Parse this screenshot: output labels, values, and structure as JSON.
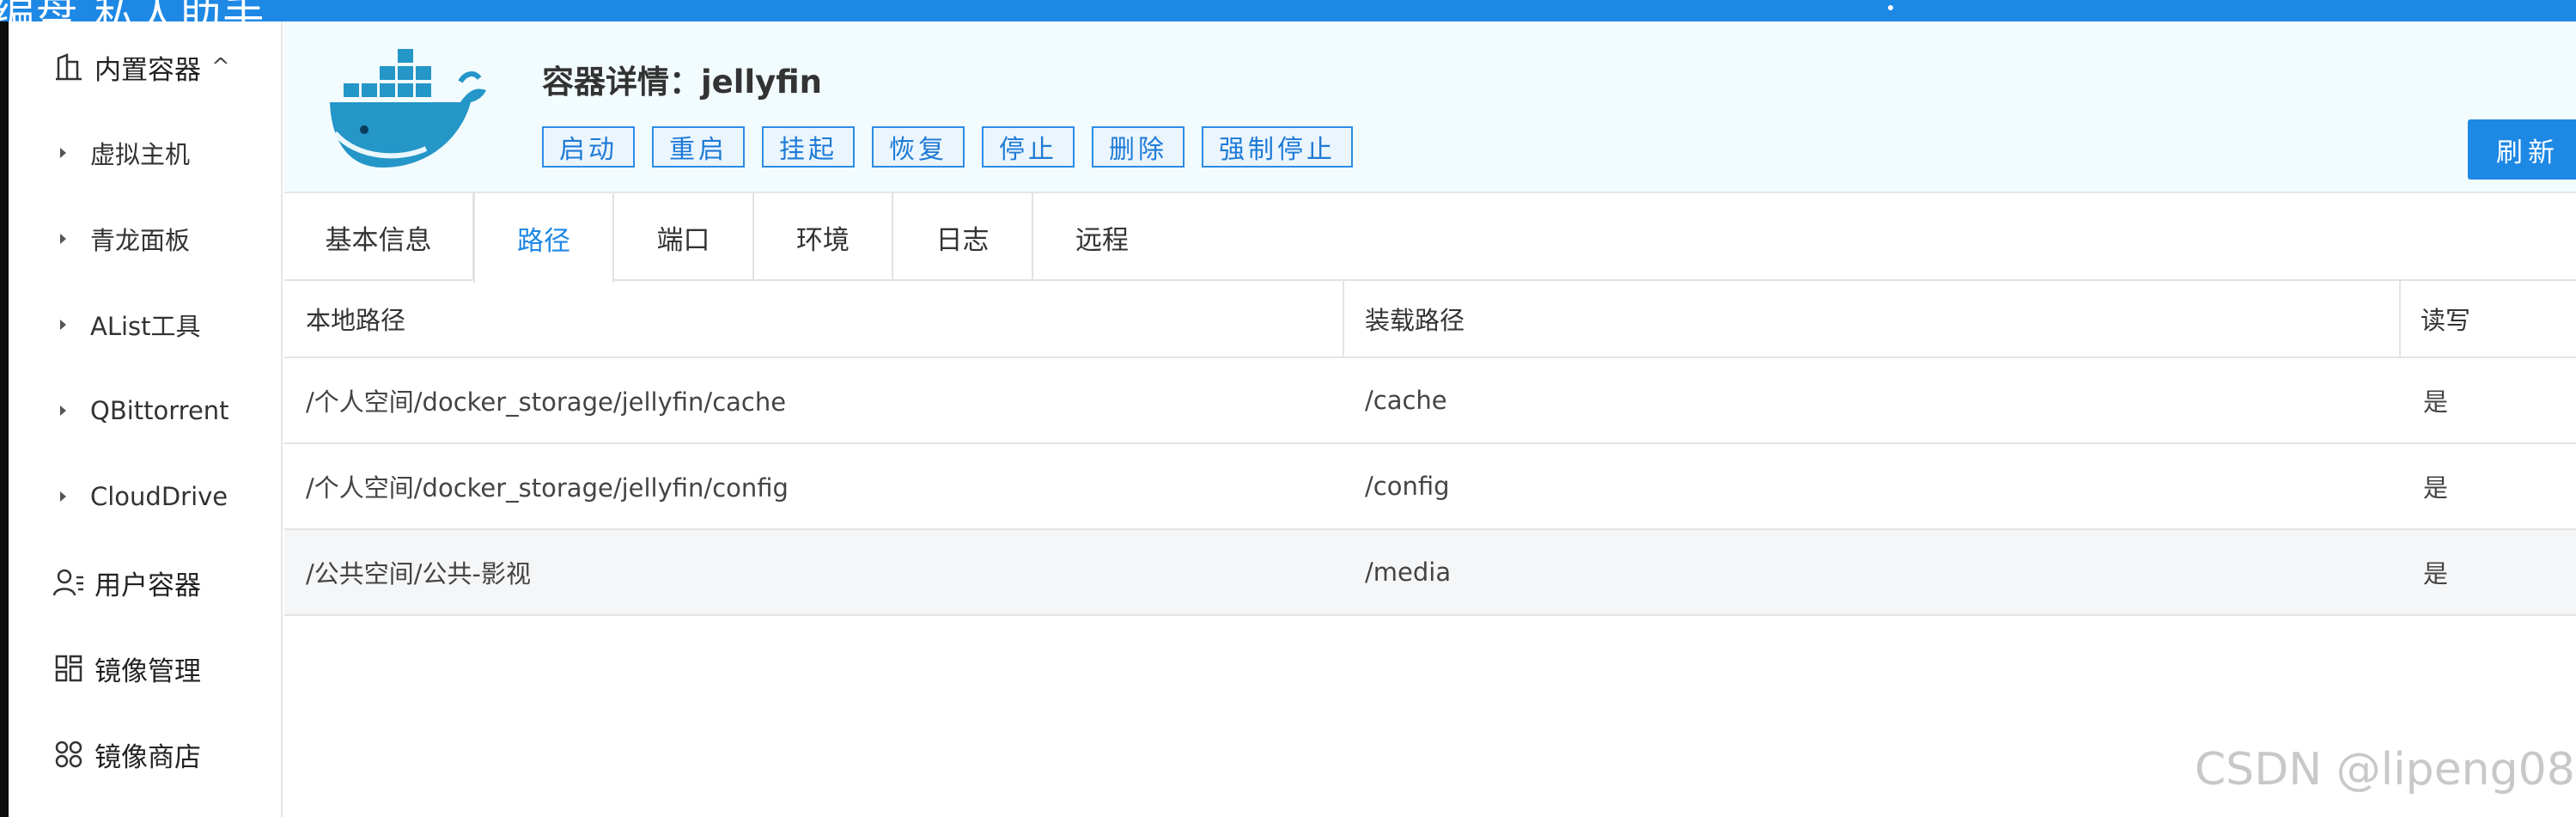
{
  "topbar": {
    "brand_text": "编盘 私人助手"
  },
  "sidebar": {
    "builtin": {
      "label": "内置容器",
      "chevron": "^"
    },
    "sub_items": [
      {
        "label": "虚拟主机"
      },
      {
        "label": "青龙面板"
      },
      {
        "label": "AList工具"
      },
      {
        "label": "QBittorrent"
      },
      {
        "label": "CloudDrive"
      }
    ],
    "items": [
      {
        "label": "用户容器",
        "icon": "user-list-icon"
      },
      {
        "label": "镜像管理",
        "icon": "grid-icon"
      },
      {
        "label": "镜像商店",
        "icon": "apps-icon"
      }
    ]
  },
  "header": {
    "title": "容器详情：jellyfin",
    "actions": [
      "启动",
      "重启",
      "挂起",
      "恢复",
      "停止",
      "删除",
      "强制停止"
    ],
    "refresh": "刷新"
  },
  "tabs": [
    "基本信息",
    "路径",
    "端口",
    "环境",
    "日志",
    "远程"
  ],
  "active_tab": "路径",
  "table": {
    "columns": [
      "本地路径",
      "装载路径",
      "读写"
    ],
    "rows": [
      [
        "/个人空间/docker_storage/jellyfin/cache",
        "/cache",
        "是"
      ],
      [
        "/个人空间/docker_storage/jellyfin/config",
        "/config",
        "是"
      ],
      [
        "/公共空间/公共-影视",
        "/media",
        "是"
      ]
    ]
  },
  "watermark": "CSDN @lipeng08",
  "colors": {
    "accent": "#1e88e5",
    "header_bg": "#f2fbfd"
  }
}
